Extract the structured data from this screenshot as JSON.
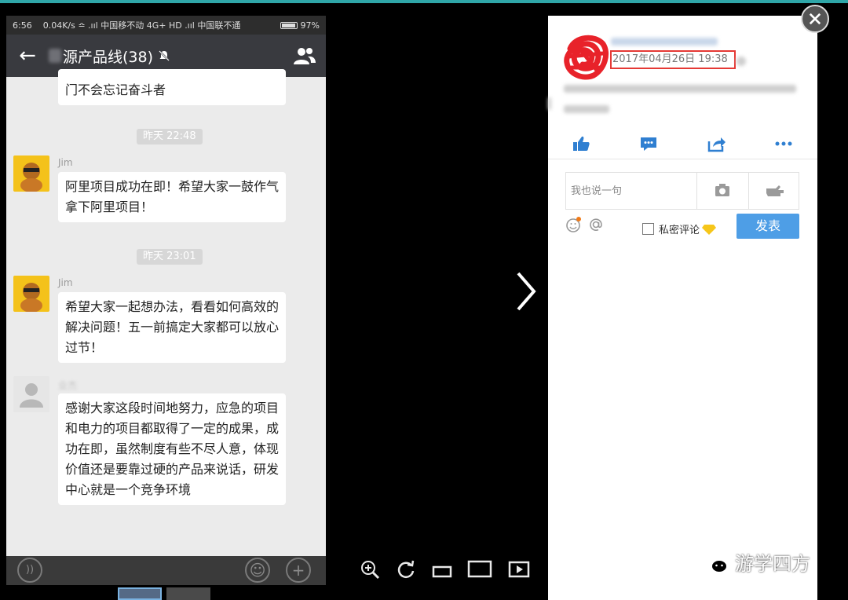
{
  "phone": {
    "statusbar": {
      "time": "6:56",
      "network": "0.04K/s ≏ .ııl 中国移不动 4G+ HD .ııl 中国联不通",
      "battery": "97%"
    },
    "header": {
      "title": "源产品线(38)"
    },
    "messages": {
      "first_text": "门不会忘记奋斗者",
      "time1": "昨天 22:48",
      "m1_sender": "Jim",
      "m1_text": "阿里项目成功在即！希望大家一鼓作气拿下阿里项目！",
      "time2": "昨天 23:01",
      "m2_sender": "Jim",
      "m2_text": "希望大家一起想办法，看看如何高效的解决问题！五一前搞定大家都可以放心过节！",
      "m3_sender": "业杰",
      "m3_text": "感谢大家这段时间地努力，应急的项目和电力的项目都取得了一定的成果，成功在即，虽然制度有些不尽人意，体现价值还是要靠过硬的产品来说话，研发中心就是一个竞争环境"
    },
    "input_bar": {
      "voice_icon": "voice-icon",
      "emoji_icon": "emoji-icon",
      "plus_icon": "plus-icon"
    }
  },
  "viewer": {
    "tools": [
      "zoom-in-icon",
      "rotate-icon",
      "fit-width-icon",
      "original-size-icon",
      "slideshow-icon"
    ]
  },
  "panel": {
    "timestamp": "2017年04月26日 19:38",
    "comment_placeholder": "我也说一句",
    "private_label": "私密评论",
    "post_button": "发表",
    "highlight_color": "#e53935",
    "accent_color": "#4e9ee6"
  },
  "watermark": {
    "text": "游学四方"
  }
}
